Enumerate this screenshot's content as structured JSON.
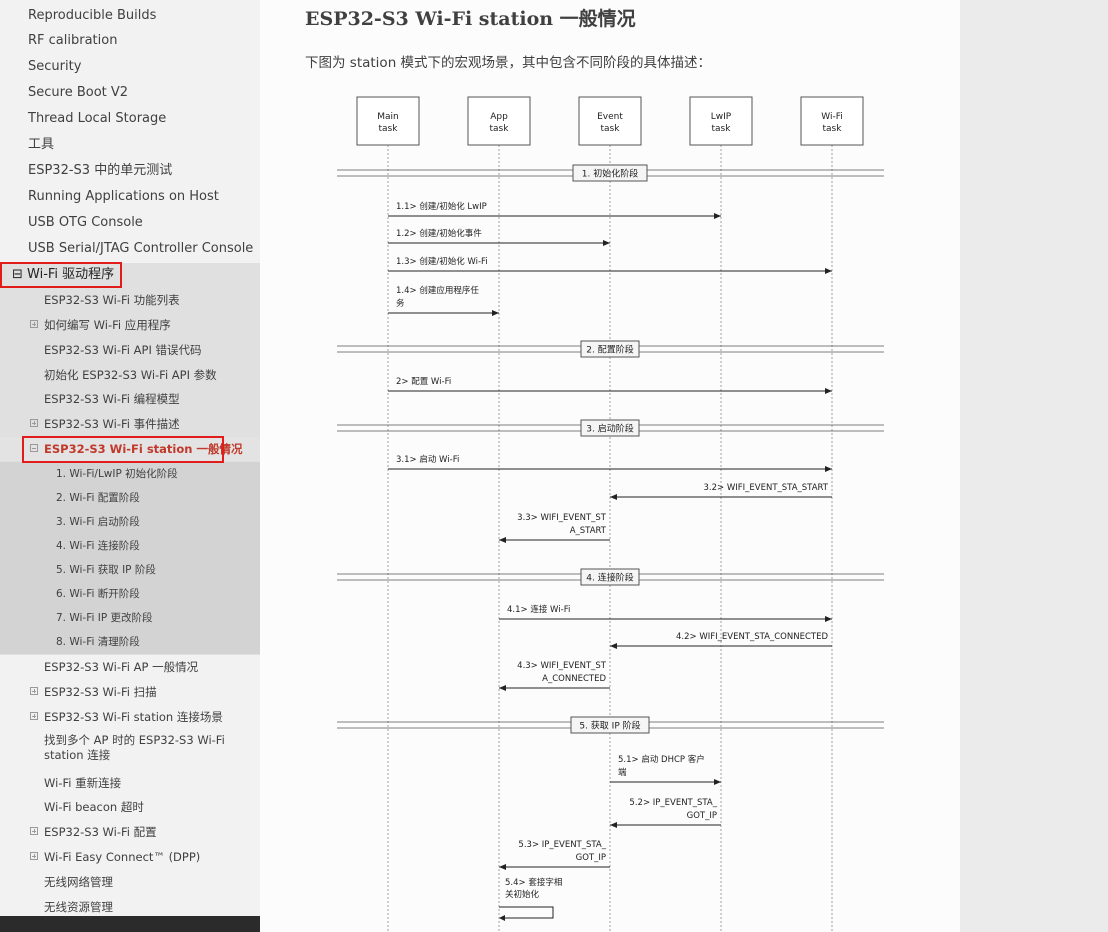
{
  "sidebar": {
    "items": [
      {
        "label": "Reproducible Builds"
      },
      {
        "label": "RF calibration"
      },
      {
        "label": "Security"
      },
      {
        "label": "Secure Boot V2"
      },
      {
        "label": "Thread Local Storage"
      },
      {
        "label": "工具"
      },
      {
        "label": "ESP32-S3 中的单元测试"
      },
      {
        "label": "Running Applications on Host"
      },
      {
        "label": "USB OTG Console"
      },
      {
        "label": "USB Serial/JTAG Controller Console"
      }
    ],
    "wifi_section": {
      "label": "⊟ Wi-Fi 驱动程序",
      "children": [
        {
          "label": "ESP32-S3 Wi-Fi 功能列表",
          "expand": ""
        },
        {
          "label": "如何编写 Wi-Fi 应用程序",
          "expand": "plus"
        },
        {
          "label": "ESP32-S3 Wi-Fi API 错误代码",
          "expand": ""
        },
        {
          "label": "初始化 ESP32-S3 Wi-Fi API 参数",
          "expand": ""
        },
        {
          "label": "ESP32-S3 Wi-Fi 编程模型",
          "expand": ""
        },
        {
          "label": "ESP32-S3 Wi-Fi 事件描述",
          "expand": "plus"
        },
        {
          "label": "ESP32-S3 Wi-Fi station 一般情况",
          "expand": "minus"
        }
      ],
      "current_children": [
        {
          "label": "1. Wi-Fi/LwIP 初始化阶段"
        },
        {
          "label": "2. Wi-Fi 配置阶段"
        },
        {
          "label": "3. Wi-Fi 启动阶段"
        },
        {
          "label": "4. Wi-Fi 连接阶段"
        },
        {
          "label": "5. Wi-Fi 获取 IP 阶段"
        },
        {
          "label": "6. Wi-Fi 断开阶段"
        },
        {
          "label": "7. Wi-Fi IP 更改阶段"
        },
        {
          "label": "8. Wi-Fi 清理阶段"
        }
      ],
      "after": [
        {
          "label": "ESP32-S3 Wi-Fi AP 一般情况",
          "expand": ""
        },
        {
          "label": "ESP32-S3 Wi-Fi 扫描",
          "expand": "plus"
        },
        {
          "label": "ESP32-S3 Wi-Fi station 连接场景",
          "expand": "plus"
        },
        {
          "label": "找到多个 AP 时的 ESP32-S3 Wi-Fi station 连接",
          "expand": "",
          "line1": "找到多个 AP 时的 ESP32-S3 Wi-Fi",
          "line2": "station 连接"
        },
        {
          "label": "Wi-Fi 重新连接",
          "expand": ""
        },
        {
          "label": "Wi-Fi beacon 超时",
          "expand": ""
        },
        {
          "label": "ESP32-S3 Wi-Fi 配置",
          "expand": "plus"
        },
        {
          "label": "Wi-Fi Easy Connect™ (DPP)",
          "expand": "plus"
        },
        {
          "label": "无线网络管理",
          "expand": ""
        },
        {
          "label": "无线资源管理",
          "expand": ""
        }
      ]
    }
  },
  "main": {
    "title": "ESP32-S3 Wi-Fi station 一般情况",
    "intro": "下图为 station 模式下的宏观场景，其中包含不同阶段的具体描述："
  },
  "diagram": {
    "lanes": [
      {
        "line1": "Main",
        "line2": "task"
      },
      {
        "line1": "App",
        "line2": "task"
      },
      {
        "line1": "Event",
        "line2": "task"
      },
      {
        "line1": "LwIP",
        "line2": "task"
      },
      {
        "line1": "Wi-Fi",
        "line2": "task"
      }
    ],
    "phases": [
      {
        "label": "1. 初始化阶段"
      },
      {
        "label": "2. 配置阶段"
      },
      {
        "label": "3. 启动阶段"
      },
      {
        "label": "4. 连接阶段"
      },
      {
        "label": "5. 获取 IP 阶段"
      }
    ],
    "messages": [
      {
        "text": [
          "1.1> 创建/初始化 LwIP"
        ],
        "from": 0,
        "to": 3
      },
      {
        "text": [
          "1.2> 创建/初始化事件"
        ],
        "from": 0,
        "to": 2
      },
      {
        "text": [
          "1.3> 创建/初始化 Wi-Fi"
        ],
        "from": 0,
        "to": 4
      },
      {
        "text": [
          "1.4> 创建应用程序任",
          "务"
        ],
        "from": 0,
        "to": 1
      },
      {
        "text": [
          "2> 配置 Wi-Fi"
        ],
        "from": 0,
        "to": 4
      },
      {
        "text": [
          "3.1> 启动 Wi-Fi"
        ],
        "from": 0,
        "to": 4
      },
      {
        "text": [
          "3.2> WIFI_EVENT_STA_START"
        ],
        "from": 4,
        "to": 2
      },
      {
        "text": [
          "3.3> WIFI_EVENT_ST",
          "A_START"
        ],
        "from": 2,
        "to": 1
      },
      {
        "text": [
          "4.1> 连接 Wi-Fi"
        ],
        "from": 1,
        "to": 4
      },
      {
        "text": [
          "4.2> WIFI_EVENT_STA_CONNECTED"
        ],
        "from": 4,
        "to": 2
      },
      {
        "text": [
          "4.3> WIFI_EVENT_ST",
          "A_CONNECTED"
        ],
        "from": 2,
        "to": 1
      },
      {
        "text": [
          "5.1> 启动 DHCP 客户",
          "端"
        ],
        "from": 2,
        "to": 3
      },
      {
        "text": [
          "5.2> IP_EVENT_STA_",
          "GOT_IP"
        ],
        "from": 3,
        "to": 2
      },
      {
        "text": [
          "5.3> IP_EVENT_STA_",
          "GOT_IP"
        ],
        "from": 2,
        "to": 1
      },
      {
        "text": [
          "5.4> 套接字相",
          "关初始化"
        ],
        "from": 1,
        "to": 1
      }
    ]
  },
  "colors": {
    "highlight": "#e21b1b",
    "sidebar_bg": "#f2f2f2",
    "right_bg": "#ebebeb"
  }
}
